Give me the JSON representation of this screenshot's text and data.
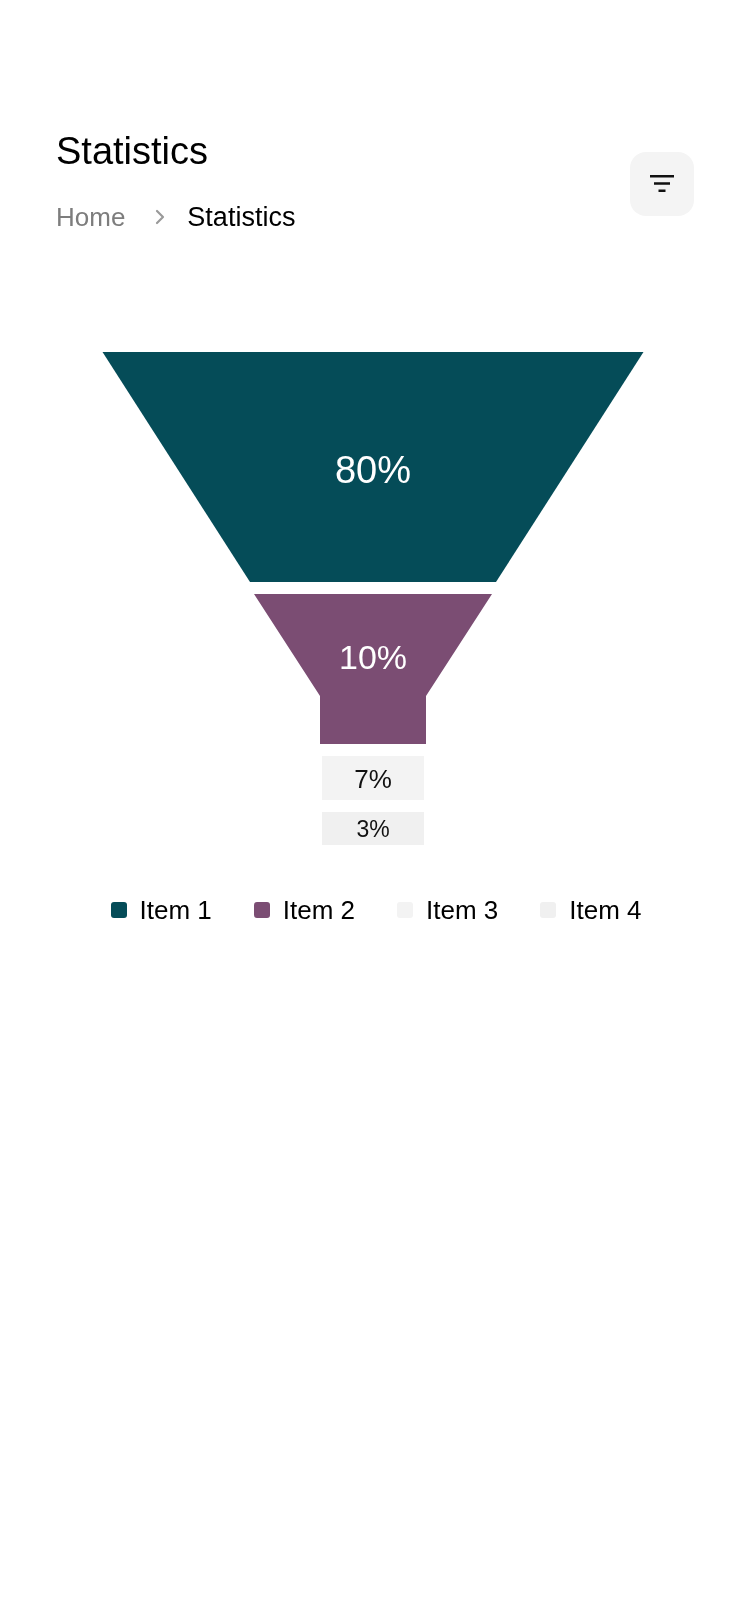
{
  "header": {
    "title": "Statistics",
    "breadcrumb": [
      {
        "label": "Home",
        "current": false
      },
      {
        "label": "Statistics",
        "current": true
      }
    ]
  },
  "funnel": {
    "segments": [
      {
        "kind": "cone",
        "label": "80%",
        "color": "#054c58"
      },
      {
        "kind": "neck",
        "label": "10%",
        "color": "#7b4d73"
      },
      {
        "kind": "block",
        "label": "7%",
        "color": "#f3f3f3"
      },
      {
        "kind": "block",
        "label": "3%",
        "color": "#f0f0f0"
      }
    ]
  },
  "legend": [
    {
      "label": "Item 1",
      "color": "#054c58"
    },
    {
      "label": "Item 2",
      "color": "#7b4d73"
    },
    {
      "label": "Item 3",
      "color": "#f3f3f3"
    },
    {
      "label": "Item 4",
      "color": "#f0f0f0"
    }
  ]
}
